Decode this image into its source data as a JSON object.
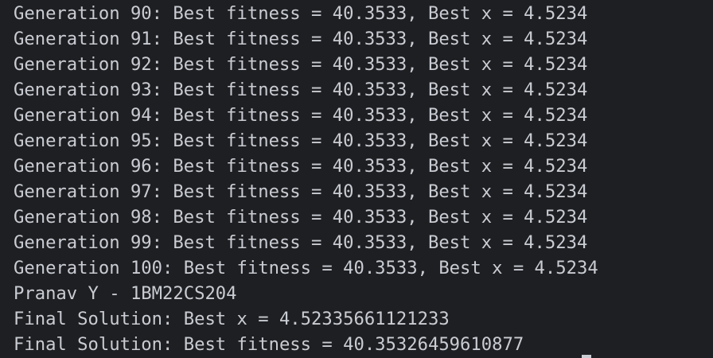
{
  "terminal": {
    "lines": [
      "Generation 90: Best fitness = 40.3533, Best x = 4.5234",
      "Generation 91: Best fitness = 40.3533, Best x = 4.5234",
      "Generation 92: Best fitness = 40.3533, Best x = 4.5234",
      "Generation 93: Best fitness = 40.3533, Best x = 4.5234",
      "Generation 94: Best fitness = 40.3533, Best x = 4.5234",
      "Generation 95: Best fitness = 40.3533, Best x = 4.5234",
      "Generation 96: Best fitness = 40.3533, Best x = 4.5234",
      "Generation 97: Best fitness = 40.3533, Best x = 4.5234",
      "Generation 98: Best fitness = 40.3533, Best x = 4.5234",
      "Generation 99: Best fitness = 40.3533, Best x = 4.5234",
      "Generation 100: Best fitness = 40.3533, Best x = 4.5234",
      "Pranav Y - 1BM22CS204",
      "Final Solution: Best x = 4.52335661121233",
      "Final Solution: Best fitness = 40.35326459610877"
    ]
  },
  "colors": {
    "background": "#1e1f22",
    "text": "#c9ccd3"
  }
}
